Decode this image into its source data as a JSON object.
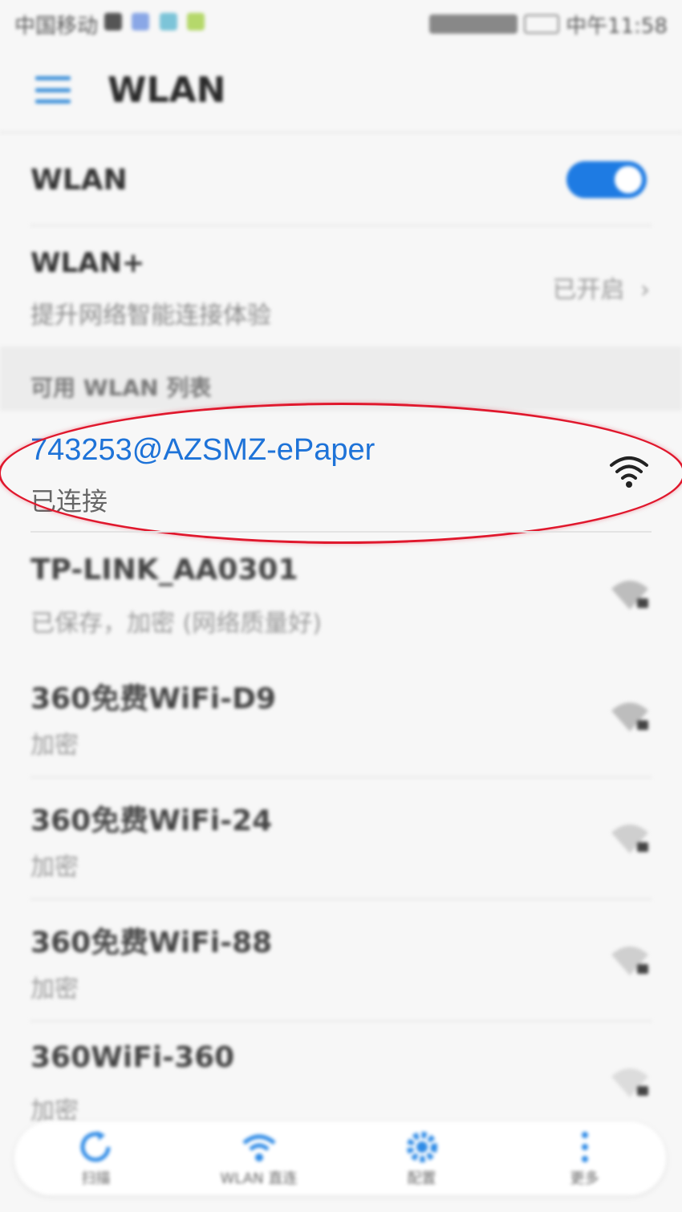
{
  "status_bar": {
    "carrier": "中国移动",
    "time": "中午11:58"
  },
  "app_bar": {
    "title": "WLAN"
  },
  "wlan_toggle": {
    "label": "WLAN",
    "enabled": true
  },
  "wlan_plus": {
    "title": "WLAN+",
    "subtitle": "提升网络智能连接体验",
    "status": "已开启"
  },
  "available_section": {
    "label": "可用 WLAN 列表"
  },
  "connected_network": {
    "name": "743253@AZSMZ-ePaper",
    "status": "已连接"
  },
  "networks": [
    {
      "name": "TP-LINK_AA0301",
      "status": "已保存，加密 (网络质量好)"
    },
    {
      "name": "360免费WiFi-D9",
      "status": "加密"
    },
    {
      "name": "360免费WiFi-24",
      "status": "加密"
    },
    {
      "name": "360免费WiFi-88",
      "status": "加密"
    },
    {
      "name": "360WiFi-360",
      "status": "加密"
    }
  ],
  "bottom_nav": {
    "items": [
      {
        "label": "扫描",
        "icon": "refresh-icon"
      },
      {
        "label": "WLAN 直连",
        "icon": "wifi-direct-icon"
      },
      {
        "label": "配置",
        "icon": "gear-icon"
      },
      {
        "label": "更多",
        "icon": "more-vertical-icon"
      }
    ]
  },
  "colors": {
    "accent": "#1e7be3",
    "highlight_ring": "#e0182d"
  }
}
